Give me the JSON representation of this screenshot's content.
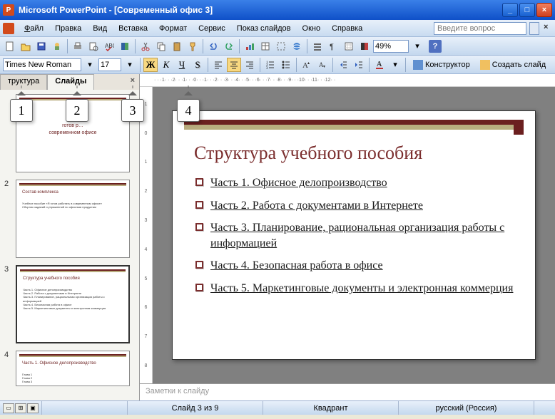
{
  "window": {
    "title": "Microsoft PowerPoint - [Современный офис 3]"
  },
  "menu": {
    "file": "Файл",
    "edit": "Правка",
    "view": "Вид",
    "insert": "Вставка",
    "format": "Формат",
    "tools": "Сервис",
    "slideshow": "Показ слайдов",
    "window": "Окно",
    "help": "Справка",
    "ask_placeholder": "Введите вопрос"
  },
  "toolbar": {
    "zoom": "49%"
  },
  "format": {
    "font": "Times New Roman",
    "size": "17",
    "bold": "Ж",
    "italic": "К",
    "underline": "Ч",
    "shadow": "S",
    "designer": "Конструктор",
    "new_slide": "Создать слайд"
  },
  "tabs": {
    "outline": "труктура",
    "slides": "Слайды"
  },
  "thumbs": [
    {
      "num": "",
      "title": "готов р…",
      "sub": "современном офисе"
    },
    {
      "num": "2",
      "title": "Состав комплекса",
      "lines": [
        "Учебное пособие «Я готов работать в современном офисе»",
        "Сборник заданий и упражнений по офисным продуктам"
      ]
    },
    {
      "num": "3",
      "title": "Структура учебного пособия",
      "lines": [
        "Часть 1. Офисное делопроизводство",
        "Часть 2. Работа с документами в Интернете",
        "Часть 3. Планирование, рациональная организация работы с информацией",
        "Часть 4. Безопасная работа в офисе",
        "Часть 5. Маркетинговые документы и электронная коммерция"
      ]
    },
    {
      "num": "4",
      "title": "Часть 1. Офисное делопроизводство",
      "lines": [
        "Глава 1",
        "Глава 2",
        "Глава 3"
      ]
    }
  ],
  "slide": {
    "title": "Структура учебного пособия",
    "items": [
      "Часть 1. Офисное делопроизводство",
      "Часть 2. Работа с документами в Интернете",
      "Часть 3. Планирование, рациональная организация работы с информацией",
      "Часть 4. Безопасная работа в офисе",
      "Часть 5. Маркетинговые документы и электронная коммерция"
    ]
  },
  "notes": {
    "placeholder": "Заметки к слайду"
  },
  "status": {
    "slide": "Слайд 3 из 9",
    "template": "Квадрант",
    "lang": "русский (Россия)"
  },
  "ruler_h": "· · ·1· · ·2· · ·1· · ·0· · ·1· · ·2· · ·3· · ·4· · ·5· · ·6· · ·7· · ·8· · ·9· · ·10· · ·11· · ·12· ·",
  "ruler_v": [
    "1",
    "0",
    "1",
    "2",
    "3",
    "4",
    "5",
    "6",
    "7",
    "8"
  ],
  "callouts": {
    "c1": "1",
    "c2": "2",
    "c3": "3",
    "c4": "4"
  }
}
